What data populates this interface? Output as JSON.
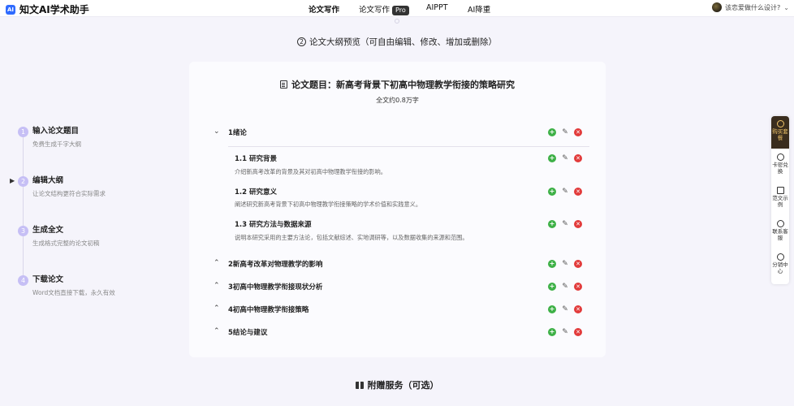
{
  "brand": {
    "logo_text": "AI",
    "name": "知文AI学术助手"
  },
  "nav": {
    "items": [
      {
        "label": "论文写作"
      },
      {
        "label": "论文写作"
      },
      {
        "label": "AIPPT"
      },
      {
        "label": "AI降重"
      }
    ],
    "pro_badge": "Pro"
  },
  "user": {
    "prompt": "该恋爱做什么设计?"
  },
  "steps": [
    {
      "num": "1",
      "title": "输入论文题目",
      "desc": "免费生成千字大纲"
    },
    {
      "num": "2",
      "title": "编辑大纲",
      "desc": "让论文结构更符合实际需求"
    },
    {
      "num": "3",
      "title": "生成全文",
      "desc": "生成格式完整的论文初稿"
    },
    {
      "num": "4",
      "title": "下载论文",
      "desc": "Word文档直接下载，永久有效"
    }
  ],
  "section": {
    "num": "2",
    "title": "论文大纲预览（可自由编辑、修改、增加或删除）"
  },
  "card": {
    "title": "论文题目：新高考背景下初高中物理教学衔接的策略研究",
    "subtitle": "全文约0.8万字"
  },
  "outline": {
    "chapters": [
      {
        "label": "1绪论",
        "expanded": true,
        "sections": [
          {
            "label": "1.1 研究背景",
            "desc": "介绍新高考改革的背景及其对初高中物理教学衔接的影响。"
          },
          {
            "label": "1.2 研究意义",
            "desc": "阐述研究新高考背景下初高中物理教学衔接策略的学术价值和实践意义。"
          },
          {
            "label": "1.3 研究方法与数据来源",
            "desc": "说明本研究采用的主要方法论，包括文献综述、实地调研等，以及数据收集的来源和范围。"
          }
        ]
      },
      {
        "label": "2新高考改革对物理教学的影响",
        "expanded": false
      },
      {
        "label": "3初高中物理教学衔接现状分析",
        "expanded": false
      },
      {
        "label": "4初高中物理教学衔接策略",
        "expanded": false
      },
      {
        "label": "5结论与建议",
        "expanded": false
      }
    ]
  },
  "rail": {
    "items": [
      {
        "label": "购买套餐"
      },
      {
        "label": "卡密兑换"
      },
      {
        "label": "范文示例"
      },
      {
        "label": "联系客服"
      },
      {
        "label": "分销中心"
      }
    ]
  },
  "extras": {
    "title": "附赠服务（可选）"
  },
  "icons": {
    "add": "plus-circle-icon",
    "edit": "pencil-icon",
    "delete": "x-circle-icon",
    "expanded": "chevron-down-icon",
    "collapsed": "chevron-up-icon"
  },
  "colors": {
    "add": "#3db046",
    "delete": "#e23b3b",
    "step": "#c6bff5",
    "accent": "#2f6bff"
  }
}
